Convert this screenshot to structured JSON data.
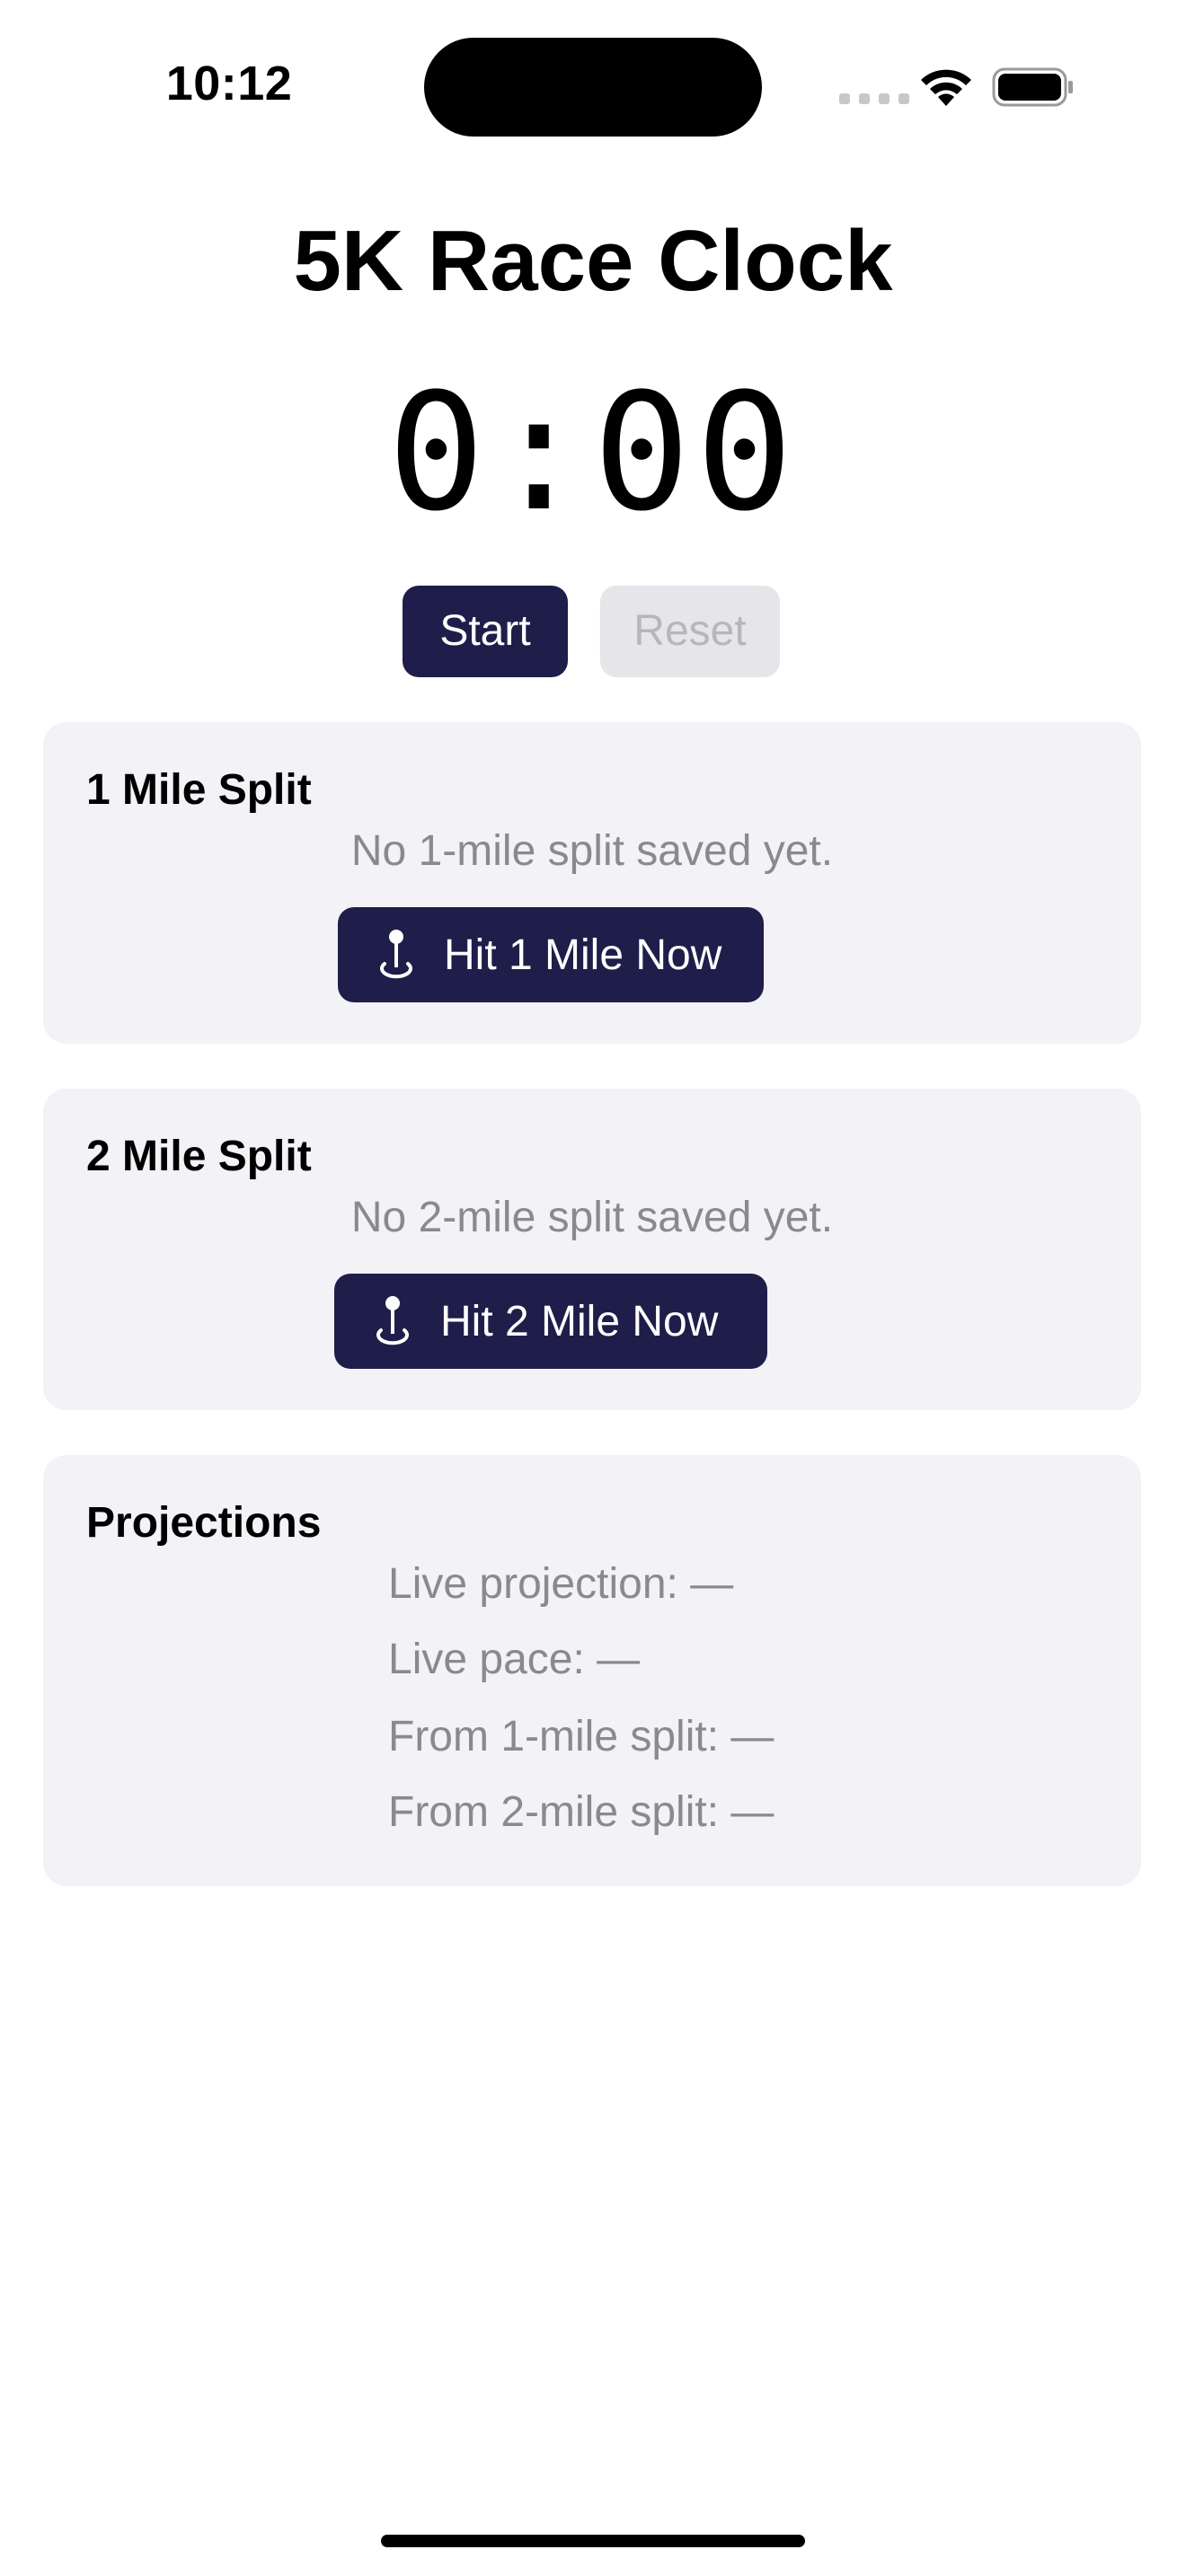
{
  "status_bar": {
    "time": "10:12",
    "icons": [
      "cellular-signal-icon",
      "wifi-icon",
      "battery-icon"
    ]
  },
  "app": {
    "title": "5K Race Clock",
    "clock_display": "0:00"
  },
  "controls": {
    "start_label": "Start",
    "reset_label": "Reset",
    "reset_enabled": false
  },
  "mile1_card": {
    "title": "1 Mile Split",
    "message": "No 1-mile split saved yet.",
    "button_label": "Hit 1 Mile Now",
    "button_icon": "mappin-icon"
  },
  "mile2_card": {
    "title": "2 Mile Split",
    "message": "No 2-mile split saved yet.",
    "button_label": "Hit 2 Mile Now",
    "button_icon": "mappin-icon"
  },
  "projections": {
    "title": "Projections",
    "lines": [
      "Live projection: —",
      "Live pace: —",
      "From 1-mile split: —",
      "From 2-mile split: —"
    ]
  },
  "colors": {
    "accent": "#1f1e4a",
    "card_background": "#f2f2f7",
    "secondary_text": "#8a8a8e",
    "disabled_button": "#e5e5ea"
  }
}
